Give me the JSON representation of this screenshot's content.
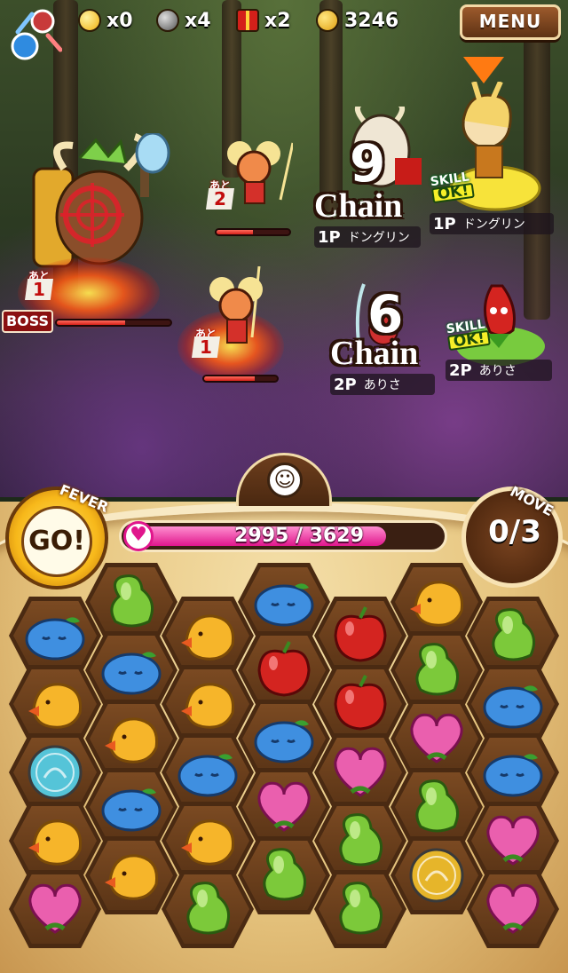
{
  "hud": {
    "egg_count": "x0",
    "bomb_count": "x4",
    "gift_count": "x2",
    "coins": "3246",
    "menu_label": "MENU"
  },
  "enemies": {
    "boss_label": "BOSS",
    "boss_ato_tag": "あと",
    "boss_turns": "1",
    "boss_hp": 0.6,
    "minion_top_ato_tag": "あと",
    "minion_top_turns": "2",
    "minion_top_hp": 0.5,
    "minion_bottom_ato_tag": "あと",
    "minion_bottom_turns": "1",
    "minion_bottom_hp": 0.7
  },
  "players": {
    "p1": {
      "chain_num": "9",
      "chain_word": "Chain",
      "tag": "1P",
      "name": "ドングリン",
      "skill_top": "SKILL",
      "skill_ok": "OK!"
    },
    "p2": {
      "chain_num": "6",
      "chain_word": "Chain",
      "tag": "2P",
      "name": "ありさ",
      "skill_top": "SKILL",
      "skill_ok": "OK!"
    }
  },
  "fever": {
    "label": "FEVER",
    "go": "GO!"
  },
  "move": {
    "label": "MOVE",
    "count": "0/3"
  },
  "hp": {
    "text": "2995 / 3629",
    "ratio": 0.825
  },
  "colors": {
    "blue": "#3f8fe0",
    "green": "#7cc93a",
    "yellow": "#f6b52a",
    "red": "#d42420",
    "pink": "#ea5fae",
    "coin_blue": "#55c4d8",
    "coin_gold": "#e6b52a"
  },
  "grid": [
    [
      "blue",
      "green",
      "yellow",
      "blue",
      "red",
      "yellow",
      "green"
    ],
    [
      "yellow",
      "blue",
      "yellow",
      "red",
      "red",
      "green",
      "blue"
    ],
    [
      "coin_blue",
      "yellow",
      "blue",
      "blue",
      "pink",
      "pink",
      "blue"
    ],
    [
      "yellow",
      "blue",
      "yellow",
      "pink",
      "green",
      "green",
      "pink"
    ],
    [
      "pink",
      "yellow",
      "green",
      "green",
      "green",
      "coin_gold",
      "pink"
    ]
  ]
}
